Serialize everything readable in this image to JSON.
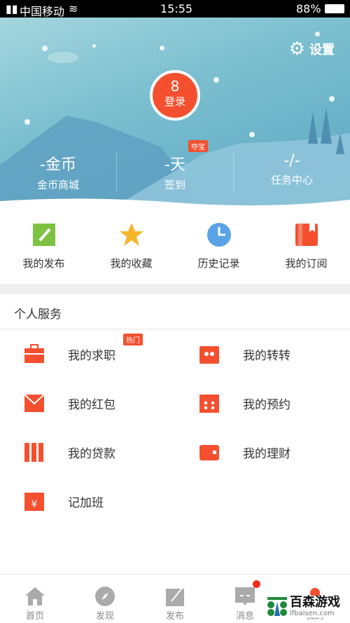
{
  "status_bar": {
    "carrier": "中国移动",
    "time": "15:55",
    "battery": "88%"
  },
  "header": {
    "settings_label": "设置",
    "login_label": "登录",
    "stats": [
      {
        "value": "-金币",
        "label": "金币商城"
      },
      {
        "value": "-天",
        "label": "签到",
        "badge": "夺宝"
      },
      {
        "value": "-/-",
        "label": "任务中心"
      }
    ]
  },
  "quick_actions": [
    {
      "label": "我的发布",
      "icon": "edit-icon",
      "color": "#7dc242"
    },
    {
      "label": "我的收藏",
      "icon": "star-icon",
      "color": "#f7b52c"
    },
    {
      "label": "历史记录",
      "icon": "clock-icon",
      "color": "#5aa3e8"
    },
    {
      "label": "我的订阅",
      "icon": "bookmark-icon",
      "color": "#f4502f"
    }
  ],
  "services": {
    "title": "个人服务",
    "items": [
      {
        "label": "我的求职",
        "icon": "briefcase-icon",
        "badge": "热门"
      },
      {
        "label": "我的转转",
        "icon": "swap-bag-icon"
      },
      {
        "label": "我的红包",
        "icon": "red-envelope-icon"
      },
      {
        "label": "我的预约",
        "icon": "calendar-icon"
      },
      {
        "label": "我的贷款",
        "icon": "loan-icon"
      },
      {
        "label": "我的理财",
        "icon": "wallet-icon"
      },
      {
        "label": "记加班",
        "icon": "overtime-calendar-icon"
      }
    ]
  },
  "bottom_nav": [
    {
      "label": "首页",
      "icon": "home-icon"
    },
    {
      "label": "发现",
      "icon": "compass-icon"
    },
    {
      "label": "发布",
      "icon": "publish-icon"
    },
    {
      "label": "消息",
      "icon": "message-icon"
    },
    {
      "label": "我的",
      "icon": "profile-icon"
    }
  ],
  "watermark": {
    "title": "百森游戏",
    "url": "lfbaisen.com"
  },
  "colors": {
    "accent": "#f4502f",
    "header": "#6bb3c9"
  }
}
